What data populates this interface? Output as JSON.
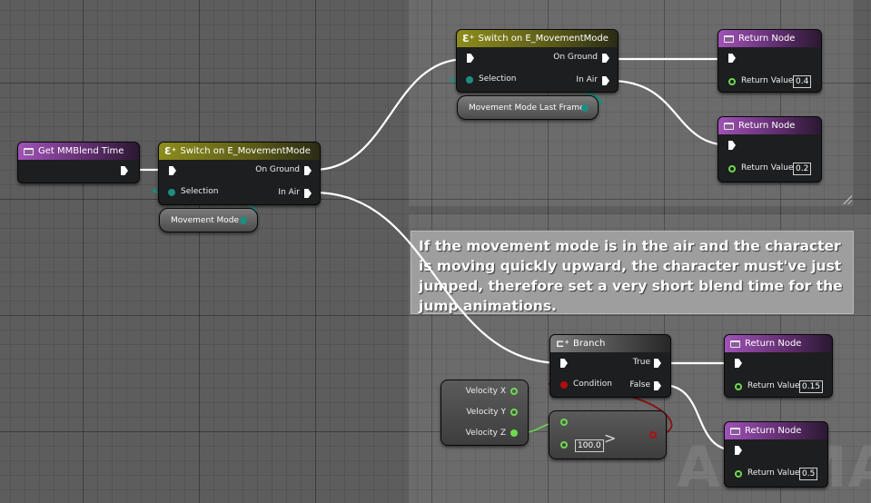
{
  "comment": {
    "text": "If the movement mode is in the air and the character is moving quickly upward, the character must've just jumped, therefore set a very short blend time for the jump animations."
  },
  "watermark": "ANIMATI",
  "nodes": {
    "get_mm_blend_time": {
      "title": "Get MMBlend Time",
      "icon": "function-icon"
    },
    "switch_movement_mode_main": {
      "title": "Switch on E_MovementMode",
      "icon": "switch-icon",
      "selection_label": "Selection",
      "on_ground_label": "On Ground",
      "in_air_label": "In Air",
      "input_value": "Movement Mode"
    },
    "switch_movement_mode_last": {
      "title": "Switch on E_MovementMode",
      "icon": "switch-icon",
      "selection_label": "Selection",
      "on_ground_label": "On Ground",
      "in_air_label": "In Air",
      "input_value": "Movement Mode Last Frame"
    },
    "return_ground": {
      "title": "Return Node",
      "return_label": "Return Value",
      "value": "0.4"
    },
    "return_air": {
      "title": "Return Node",
      "return_label": "Return Value",
      "value": "0.2"
    },
    "branch": {
      "title": "Branch",
      "icon": "branch-icon",
      "condition_label": "Condition",
      "true_label": "True",
      "false_label": "False"
    },
    "return_true": {
      "title": "Return Node",
      "return_label": "Return Value",
      "value": "0.15"
    },
    "return_false": {
      "title": "Return Node",
      "return_label": "Return Value",
      "value": "0.5"
    },
    "break_vector": {
      "x_label": "Velocity X",
      "y_label": "Velocity Y",
      "z_label": "Velocity Z"
    },
    "greater_than": {
      "value": "100.0",
      "operator": ">"
    }
  },
  "colors": {
    "exec_wire": "#ffffff",
    "bool_wire": "#8a0f0f",
    "float_wire": "#6dd94f",
    "enum_wire": "#1c8d80",
    "function_header": "#a052b8",
    "switch_header": "#8d8d1c"
  }
}
